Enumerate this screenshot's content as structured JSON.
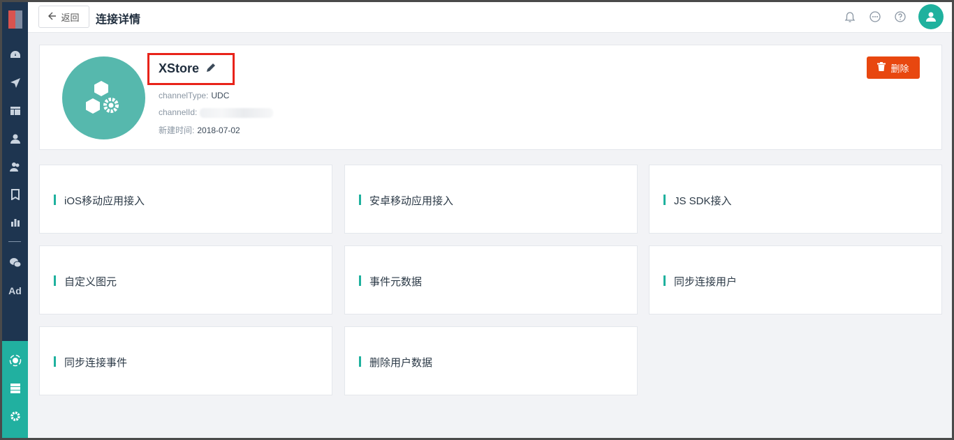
{
  "header": {
    "back_label": "返回",
    "title": "连接详情"
  },
  "sidebar": {
    "items": [
      "dashboard-icon",
      "send-icon",
      "layout-icon",
      "user-icon",
      "users-icon",
      "bookmark-icon",
      "bar-chart-icon",
      "wechat-icon",
      "ad-icon"
    ],
    "ad_label": "Ad",
    "bottom_items": [
      "connect-icon",
      "server-icon",
      "gear-icon"
    ]
  },
  "detail": {
    "name": "XStore",
    "channel_type_label": "channelType:",
    "channel_type_value": "UDC",
    "channel_id_label": "channelId:",
    "created_label": "新建时间:",
    "created_value": "2018-07-02",
    "delete_label": "删除"
  },
  "options": [
    {
      "label": "iOS移动应用接入"
    },
    {
      "label": "安卓移动应用接入"
    },
    {
      "label": "JS SDK接入"
    },
    {
      "label": "自定义图元"
    },
    {
      "label": "事件元数据"
    },
    {
      "label": "同步连接用户"
    },
    {
      "label": "同步连接事件"
    },
    {
      "label": "删除用户数据"
    }
  ],
  "colors": {
    "sidebar": "#1e3550",
    "accent": "#1fb19e",
    "danger": "#e8470f",
    "highlight": "#e8231a"
  }
}
